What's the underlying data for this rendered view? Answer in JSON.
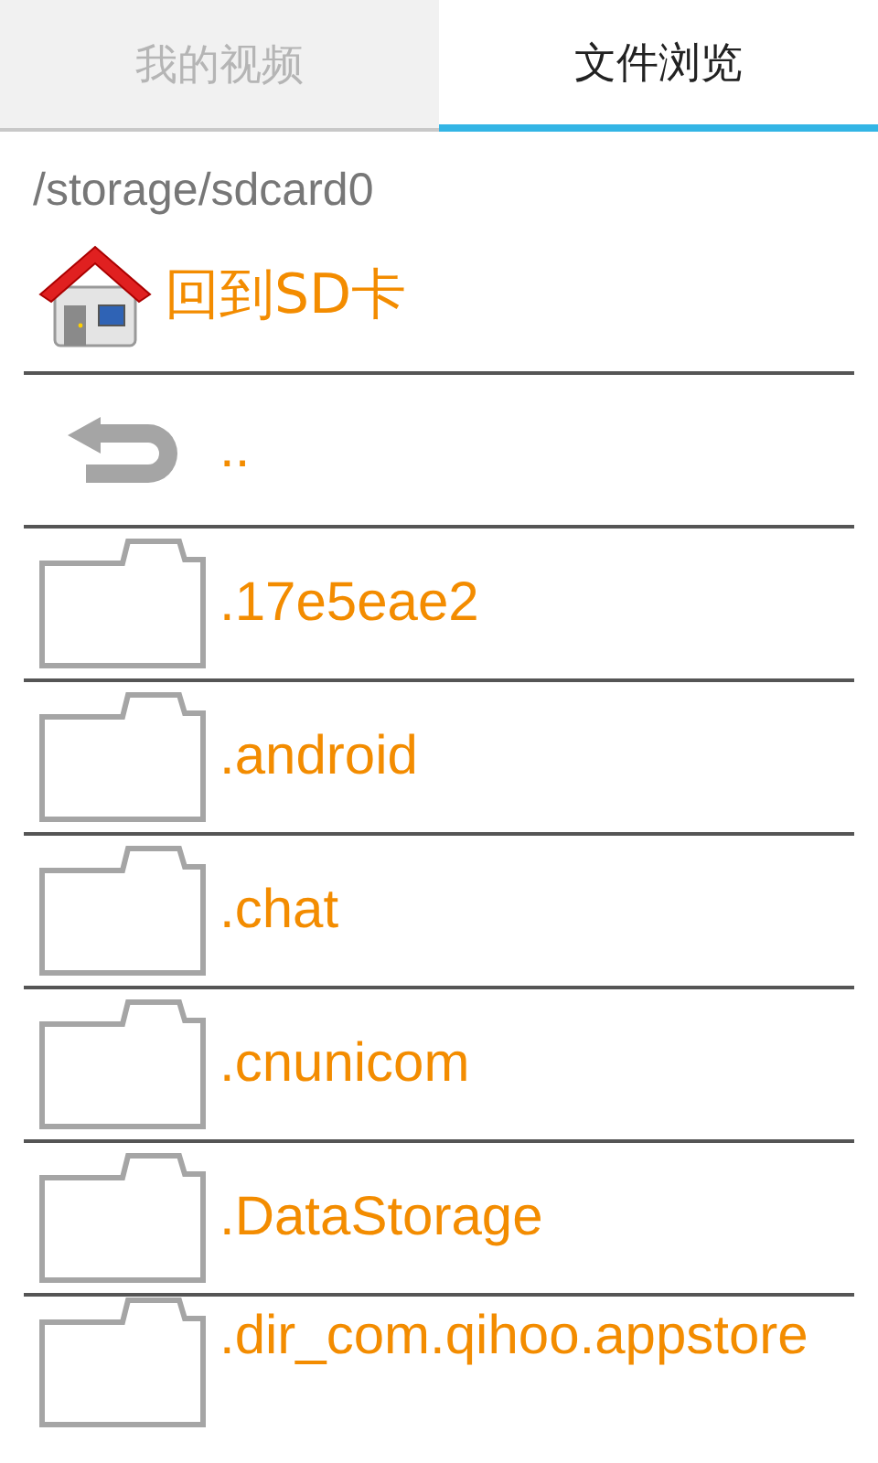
{
  "tabs": [
    {
      "label": "我的视频",
      "selected": false
    },
    {
      "label": "文件浏览",
      "selected": true
    }
  ],
  "path": "/storage/sdcard0",
  "home": {
    "label": "回到SD卡"
  },
  "entries": [
    {
      "kind": "back",
      "name": ".."
    },
    {
      "kind": "folder",
      "name": ".17e5eae2"
    },
    {
      "kind": "folder",
      "name": ".android"
    },
    {
      "kind": "folder",
      "name": ".chat"
    },
    {
      "kind": "folder",
      "name": ".cnunicom"
    },
    {
      "kind": "folder",
      "name": ".DataStorage"
    },
    {
      "kind": "folder",
      "name": ".dir_com.qihoo.appstore"
    }
  ]
}
